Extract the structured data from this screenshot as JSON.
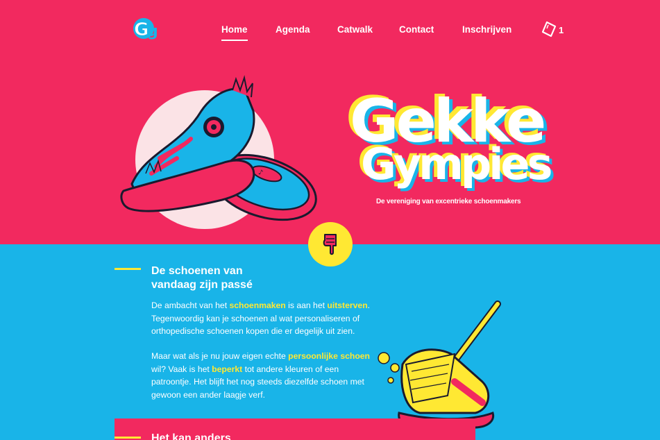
{
  "logo": {
    "text": "Gg"
  },
  "nav": {
    "items": [
      {
        "label": "Home",
        "active": true
      },
      {
        "label": "Agenda"
      },
      {
        "label": "Catwalk"
      },
      {
        "label": "Contact"
      },
      {
        "label": "Inschrijven"
      }
    ],
    "ticket_icon": "ticket-icon",
    "ticket_count": "1"
  },
  "hero": {
    "title_line1": "Gekke",
    "title_line2": "Gympies",
    "subtitle": "De vereniging van excentrieke schoenmakers"
  },
  "section1": {
    "heading_line1": "De schoenen van",
    "heading_line2": "vandaag zijn passé",
    "p1": {
      "a": "De ambacht van het ",
      "hl1": "schoenmaken",
      "b": " is aan het ",
      "hl2": "uitsterven",
      "c": ". Tegenwoordig kan je schoenen al wat personaliseren of orthopedische schoenen kopen die er degelijk uit zien."
    },
    "p2": {
      "a": "Maar wat als je nu jouw eigen echte ",
      "hl1": "persoonlijke schoen",
      "b": " wil? Vaak is het ",
      "hl2": "beperkt",
      "c": " tot andere kleuren of een patroontje. Het blijft het nog steeds diezelfde schoen met gewoon een ander laagje verf."
    }
  },
  "section2": {
    "heading": "Het kan anders"
  },
  "colors": {
    "pink": "#f2295f",
    "blue": "#19b4e8",
    "yellow": "#ffe833"
  }
}
